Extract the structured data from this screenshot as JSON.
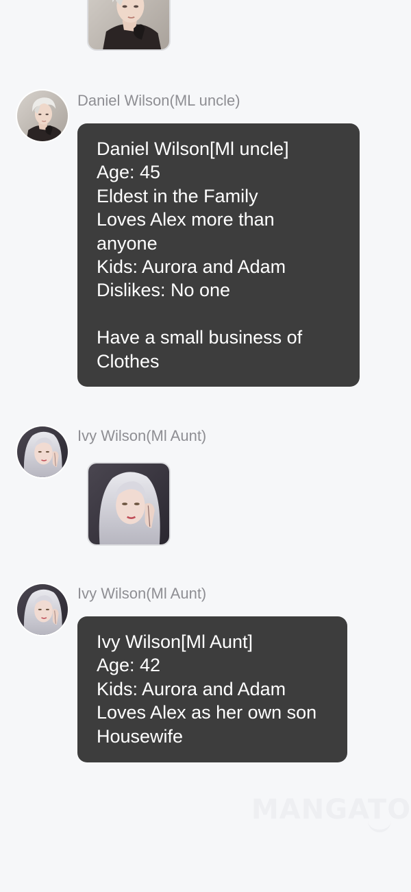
{
  "chat": {
    "messages": [
      {
        "type": "image",
        "sender": "",
        "avatar_icon": "man-portrait-avatar"
      },
      {
        "type": "text",
        "sender": "Daniel Wilson(ML uncle)",
        "avatar_icon": "man-portrait-avatar",
        "lines": [
          "Daniel Wilson[Ml uncle]",
          "Age: 45",
          "Eldest in the Family",
          "Loves Alex more than",
          "anyone",
          "Kids: Aurora and Adam",
          "Dislikes: No one",
          "",
          "Have a small business of",
          "Clothes"
        ]
      },
      {
        "type": "image",
        "sender": "Ivy Wilson(Ml Aunt)",
        "avatar_icon": "woman-portrait-avatar"
      },
      {
        "type": "text",
        "sender": "Ivy Wilson(Ml Aunt)",
        "avatar_icon": "woman-portrait-avatar",
        "lines": [
          "Ivy Wilson[Ml Aunt]",
          "Age: 42",
          "Kids: Aurora and Adam",
          "Loves Alex as her own son",
          "Housewife"
        ]
      }
    ]
  },
  "watermark": {
    "text": "MANGATOON"
  },
  "colors": {
    "background": "#f6f7f9",
    "bubble": "#3d3d3d",
    "bubble_text": "#ffffff",
    "sender_name": "#8e8e93"
  }
}
